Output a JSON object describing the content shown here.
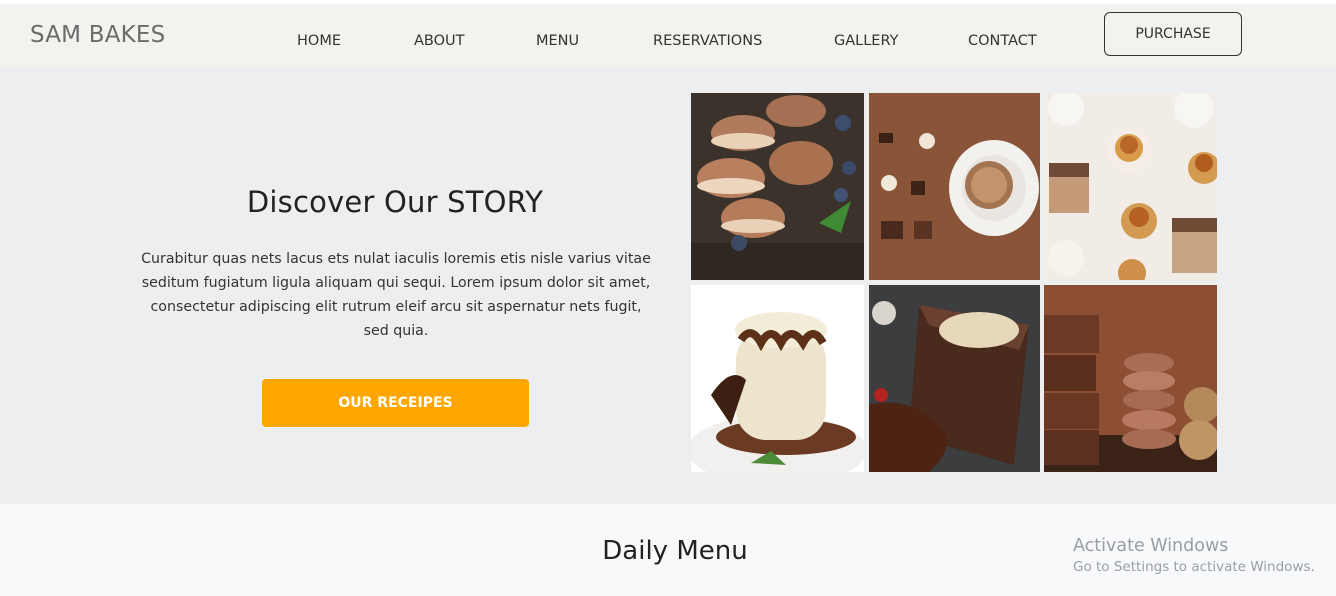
{
  "navbar": {
    "brand": "SAM BAKES",
    "links": [
      "HOME",
      "ABOUT",
      "MENU",
      "RESERVATIONS",
      "GALLERY",
      "CONTACT"
    ],
    "purchase_label": "PURCHASE"
  },
  "hero": {
    "title": "Discover Our STORY",
    "paragraph": "Curabitur quas nets lacus ets nulat iaculis loremis etis nisle varius vitae seditum fugiatum ligula aliquam qui sequi. Lorem ipsum dolor sit amet, consectetur adipiscing elit rutrum eleif arcu sit aspernatur nets fugit, sed quia.",
    "button_label": "OUR RECEIPES",
    "button_color": "#ffa600"
  },
  "gallery": {
    "images": [
      "macarons-image",
      "coffee-cup-image",
      "caramel-pastries-image",
      "panna-cotta-image",
      "chocolate-cake-image",
      "brownies-macarons-image"
    ]
  },
  "daily_menu": {
    "title": "Daily Menu"
  },
  "os_watermark": {
    "line1": "Activate Windows",
    "line2": "Go to Settings to activate Windows."
  }
}
